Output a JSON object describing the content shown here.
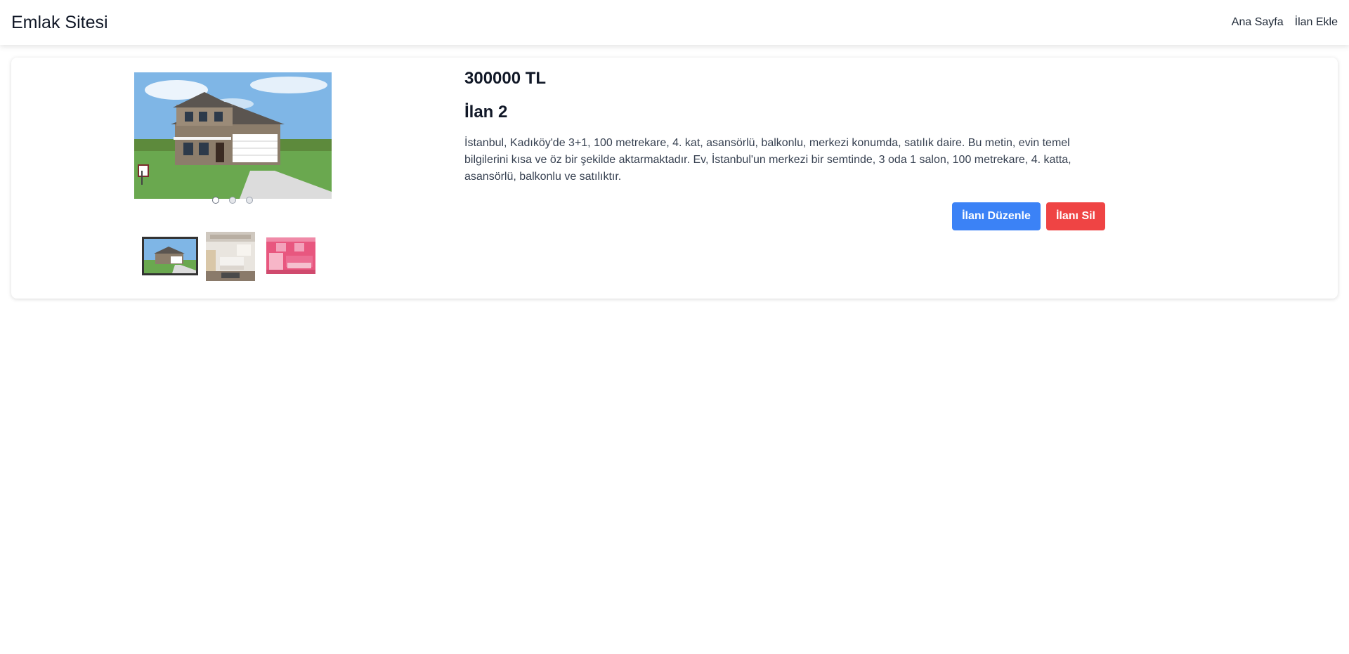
{
  "navbar": {
    "brand": "Emlak Sitesi",
    "links": [
      "Ana Sayfa",
      "İlan Ekle"
    ]
  },
  "listing": {
    "price": "300000 TL",
    "title": "İlan 2",
    "description": "İstanbul, Kadıköy'de 3+1, 100 metrekare, 4. kat, asansörlü, balkonlu, merkezi konumda, satılık daire. Bu metin, evin temel bilgilerini kısa ve öz bir şekilde aktarmaktadır. Ev, İstanbul'un merkezi bir semtinde, 3 oda 1 salon, 100 metrekare, 4. katta, asansörlü, balkonlu ve satılıktır.",
    "edit_label": "İlanı Düzenle",
    "delete_label": "İlanı Sil"
  },
  "gallery": {
    "image_count": 3,
    "active_index": 0
  },
  "colors": {
    "primary": "#3b82f6",
    "danger": "#ef4444"
  }
}
